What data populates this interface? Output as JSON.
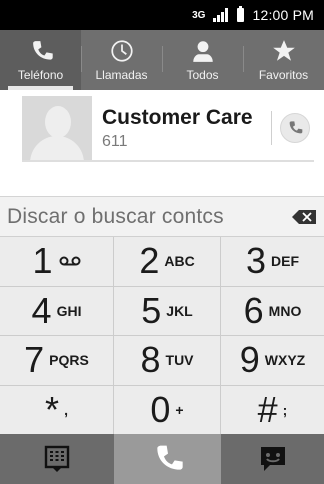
{
  "status": {
    "network": "3G",
    "time": "12:00 PM"
  },
  "tabs": [
    {
      "label": "Teléfono",
      "icon": "phone-icon",
      "active": true
    },
    {
      "label": "Llamadas",
      "icon": "clock-icon",
      "active": false
    },
    {
      "label": "Todos",
      "icon": "person-icon",
      "active": false
    },
    {
      "label": "Favoritos",
      "icon": "star-icon",
      "active": false
    }
  ],
  "contact": {
    "name": "Customer Care",
    "number": "611"
  },
  "search": {
    "placeholder": "Discar o buscar contcs"
  },
  "keypad": {
    "keys": [
      {
        "digit": "1",
        "letters": ""
      },
      {
        "digit": "2",
        "letters": "ABC"
      },
      {
        "digit": "3",
        "letters": "DEF"
      },
      {
        "digit": "4",
        "letters": "GHI"
      },
      {
        "digit": "5",
        "letters": "JKL"
      },
      {
        "digit": "6",
        "letters": "MNO"
      },
      {
        "digit": "7",
        "letters": "PQRS"
      },
      {
        "digit": "8",
        "letters": "TUV"
      },
      {
        "digit": "9",
        "letters": "WXYZ"
      },
      {
        "digit": "*",
        "letters": ","
      },
      {
        "digit": "0",
        "letters": "+"
      },
      {
        "digit": "#",
        "letters": ";"
      }
    ]
  },
  "bottom_bar": {
    "left_icon": "dialpad-icon",
    "center_icon": "call-icon",
    "right_icon": "message-icon"
  },
  "colors": {
    "tab_bar": "#6f6f6f",
    "keypad_bg": "#eeeeee",
    "call_button": "#9a9a9a"
  }
}
